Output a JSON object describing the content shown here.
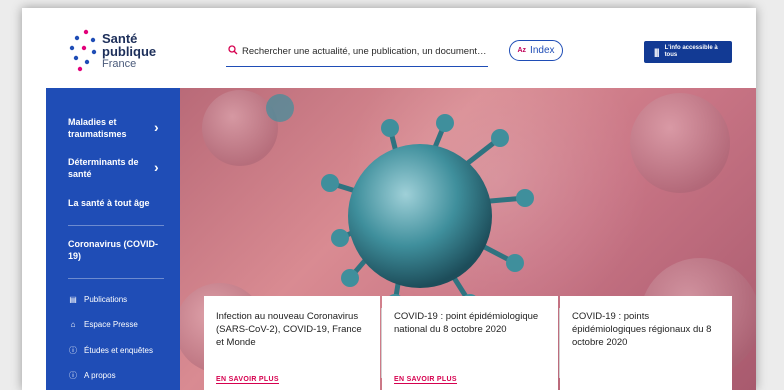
{
  "logo": {
    "line1": "Santé",
    "line2": "publique",
    "line3": "France"
  },
  "search": {
    "placeholder": "Rechercher une actualité, une publication, un document…"
  },
  "index": {
    "icon_text": "Az",
    "label": "Index"
  },
  "accessibility": {
    "icon_text": "|||",
    "label": "L'info accessible à tous"
  },
  "sidebar": {
    "items": [
      {
        "label": "Maladies et traumatismes"
      },
      {
        "label": "Déterminants de santé"
      },
      {
        "label": "La santé à tout âge"
      },
      {
        "label": "Coronavirus (COVID-19)"
      }
    ],
    "links": [
      {
        "label": "Publications",
        "icon": "document-icon"
      },
      {
        "label": "Espace Presse",
        "icon": "press-icon"
      },
      {
        "label": "Études et enquêtes",
        "icon": "info-icon"
      },
      {
        "label": "A propos",
        "icon": "info-icon"
      }
    ]
  },
  "cards": [
    {
      "title": "Infection au nouveau Coronavirus (SARS-CoV-2), COVID-19, France et Monde",
      "link": "EN SAVOIR PLUS"
    },
    {
      "title": "COVID-19 : point épidémiologique national du 8 octobre 2020",
      "link": "EN SAVOIR PLUS"
    },
    {
      "title": "COVID-19 : points épidémiologiques régionaux du 8 octobre 2020"
    }
  ],
  "colors": {
    "primary": "#1f4db6",
    "accent": "#d6004f",
    "navy": "#123a94"
  }
}
